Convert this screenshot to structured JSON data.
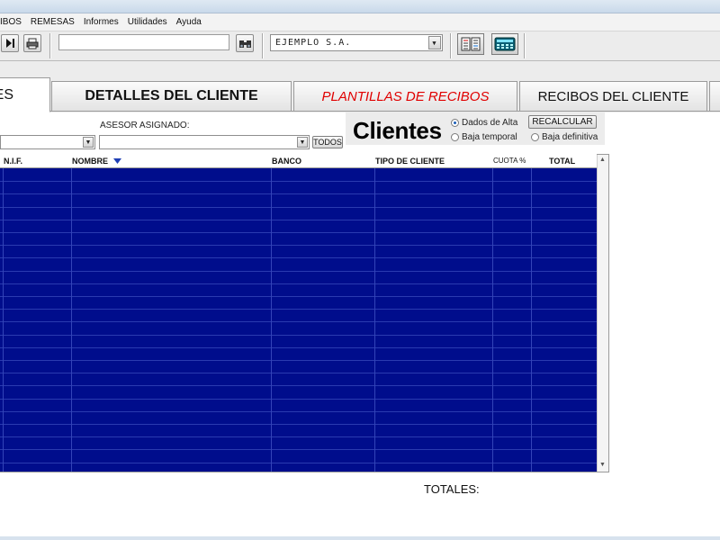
{
  "menu": [
    "IBOS",
    "REMESAS",
    "Informes",
    "Utilidades",
    "Ayuda"
  ],
  "toolbar": {
    "search_value": "",
    "company": "EJEMPLO S.A."
  },
  "tabs": [
    {
      "label": "ES"
    },
    {
      "label": "DETALLES DEL CLIENTE"
    },
    {
      "label": "PLANTILLAS DE RECIBOS"
    },
    {
      "label": "RECIBOS DEL CLIENTE"
    }
  ],
  "filters": {
    "first_value": "",
    "advisor_label": "ASESOR ASIGNADO:",
    "advisor_value": "",
    "all_button": "TODOS"
  },
  "clientes": {
    "title": "Clientes",
    "recalc": "RECALCULAR",
    "options": [
      {
        "label": "Dados de Alta",
        "selected": true
      },
      {
        "label": "Baja temporal",
        "selected": false
      },
      {
        "label": "Baja definitiva",
        "selected": false
      }
    ]
  },
  "grid": {
    "columns": [
      "N.I.F.",
      "NOMBRE",
      "BANCO",
      "TIPO DE CLIENTE",
      "CUOTA %",
      "TOTAL"
    ],
    "sorted_column": "NOMBRE",
    "row_color": "#000d8c"
  },
  "totals_label": "TOTALES:"
}
